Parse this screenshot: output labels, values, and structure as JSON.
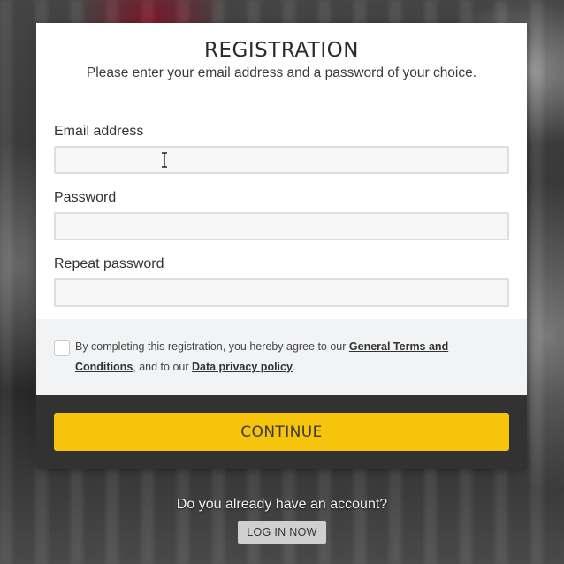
{
  "header": {
    "title": "REGISTRATION",
    "subtitle": "Please enter your email address and a password of your choice."
  },
  "form": {
    "email": {
      "label": "Email address",
      "value": "",
      "placeholder": ""
    },
    "password": {
      "label": "Password",
      "value": "",
      "placeholder": ""
    },
    "repeat_password": {
      "label": "Repeat password",
      "value": "",
      "placeholder": ""
    }
  },
  "terms": {
    "text_before": "By completing this registration, you hereby agree to our ",
    "terms_link": "General Terms and Conditions",
    "text_middle": ", and to our ",
    "privacy_link": "Data privacy policy",
    "text_after": ".",
    "checked": false
  },
  "actions": {
    "continue_label": "CONTINUE"
  },
  "login": {
    "question": "Do you already have an account?",
    "button_label": "LOG IN NOW"
  },
  "colors": {
    "accent": "#f6c40c",
    "cta_bar": "#333232",
    "terms_bg": "#f2f3f5"
  },
  "icons": {
    "text_cursor": "text-cursor-icon"
  }
}
